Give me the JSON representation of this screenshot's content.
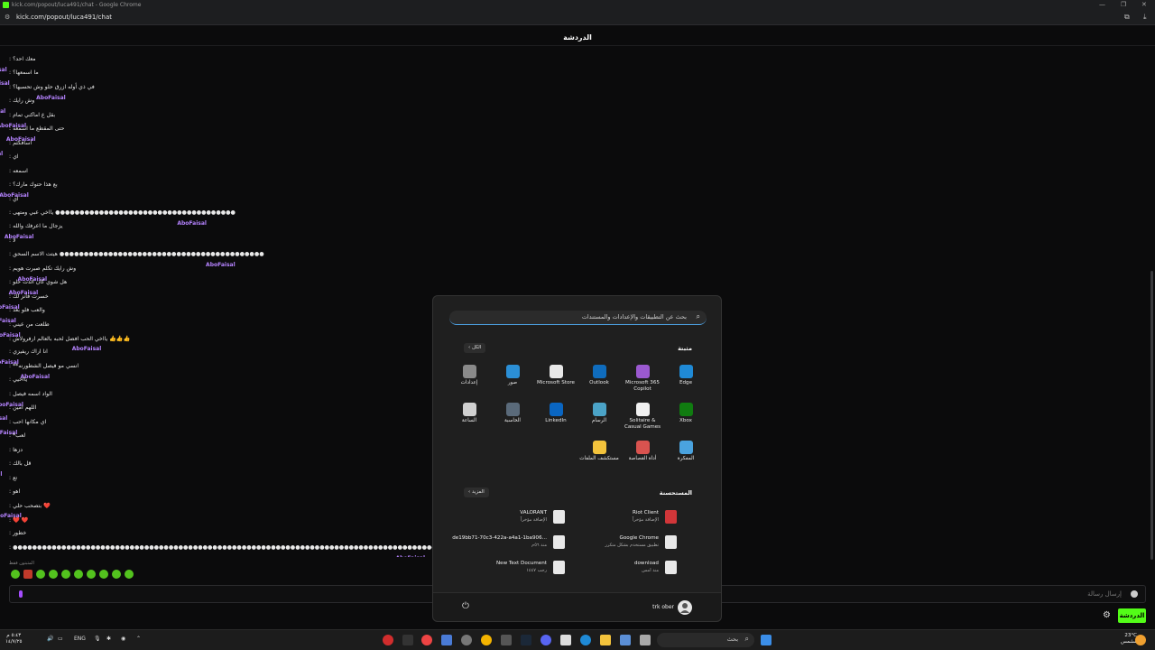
{
  "browser": {
    "window_title": "kick.com/popout/luca491/chat - Google Chrome",
    "url": "kick.com/popout/luca491/chat"
  },
  "chat": {
    "header": "الدردشة",
    "username": "AboFaisal",
    "messages": [
      "معك احد؟",
      "ما اسمعها؟",
      "في ذي أوله ازرق حلو وش تحسبها؟",
      "وش رايك",
      "بقل ع اماكني تمام",
      "حتى المقطع ما اسمعه",
      "اسافكثم",
      "اي",
      "اسمعه",
      "بع هذا حتوك مارك؟",
      "اي",
      "يااخي عبي ومتهى ●●●●●●●●●●●●●●●●●●●●●●●●●●●●●●●●●●●●●",
      "يزجال ما اعرفك والله",
      "لا",
      "هيتت الاسم السحق ●●●●●●●●●●●●●●●●●●●●●●●●●●●●●●●●●●●●●●●●●●",
      "وش رايك تكلم صبرت هويم",
      "هل شوي كان الدت حلو",
      "خسرت فانز لك",
      "والعب فلو بعد",
      "طلعت من عيني",
      "يااخي الحب افضل لحبه بالعالم ارفرولاش 👍👍👍",
      "انا اراك ريفيزي",
      "**انسي مو فيصل الشطورنه",
      "يااخيي",
      "الواد اسمه فيصل",
      "اللهم امين",
      "اي مكانها احب",
      "*لعب",
      "دزها",
      "قل بالك",
      "تع",
      "اهو",
      "بتصحب حلي ❤️",
      "❤️ ❤️",
      "خطور",
      "●●●●●●●●●●●●●●●●●●●●●●●●●●●●●●●●●●●●●●●●●●●●●●●●●●●●●●●●●●●●●●●●●●●●●●●●●●●●●●●●●●●●●●●●●●*"
    ],
    "reply_label": "المثبتون فقط",
    "input_placeholder": "إرسال رسالة",
    "send_button": "الدردشة"
  },
  "start_menu": {
    "search_placeholder": "بحث عن التطبيقات والإعدادات والمستندات",
    "pinned_title": "مثبتة",
    "all_button": "الكل",
    "pinned_apps": [
      {
        "label": "Edge",
        "icon": "edge-icon",
        "color": "#1f8ad6"
      },
      {
        "label": "Microsoft 365 Copilot",
        "icon": "m365-icon",
        "color": "#9b59d0"
      },
      {
        "label": "Outlook",
        "icon": "outlook-icon",
        "color": "#0f6cbd"
      },
      {
        "label": "Microsoft Store",
        "icon": "store-icon",
        "color": "#e8e8e8"
      },
      {
        "label": "صور",
        "icon": "photos-icon",
        "color": "#2b8fd6"
      },
      {
        "label": "إعدادات",
        "icon": "settings-icon",
        "color": "#8a8a8a"
      },
      {
        "label": "Xbox",
        "icon": "xbox-icon",
        "color": "#107c10"
      },
      {
        "label": "Solitaire & Casual Games",
        "icon": "solitaire-icon",
        "color": "#f0f0f0"
      },
      {
        "label": "الرسام",
        "icon": "paint-icon",
        "color": "#4ba3c7"
      },
      {
        "label": "LinkedIn",
        "icon": "linkedin-icon",
        "color": "#0a66c2"
      },
      {
        "label": "الحاسبة",
        "icon": "calculator-icon",
        "color": "#5a6a7a"
      },
      {
        "label": "الساعة",
        "icon": "clock-icon",
        "color": "#d0d0d0"
      },
      {
        "label": "المفكرة",
        "icon": "notepad-icon",
        "color": "#4aa3df"
      },
      {
        "label": "أداة القصاصة",
        "icon": "snipping-icon",
        "color": "#d9534f"
      },
      {
        "label": "مستكشف الملفات",
        "icon": "explorer-icon",
        "color": "#f3c33c"
      }
    ],
    "recommended_title": "المستحسنة",
    "more_button": "المزيد",
    "recommended": [
      {
        "name": "Riot Client",
        "sub": "الإضافة مؤخراً",
        "icon": "riot-icon",
        "color": "#d13639"
      },
      {
        "name": "VALORANT",
        "sub": "الإضافة مؤخراً",
        "icon": "valorant-icon",
        "color": "#e8e8e8"
      },
      {
        "name": "Google Chrome",
        "sub": "تطبيق مستخدم بشكل متكرر",
        "icon": "chrome-icon",
        "color": "#e8e8e8"
      },
      {
        "name": "de19bb71-70c3-422a-a4a1-1ba906...",
        "sub": "منذ ٥٦م",
        "icon": "doc-icon",
        "color": "#e8e8e8"
      },
      {
        "name": "download",
        "sub": "منذ امس",
        "icon": "download-doc-icon",
        "color": "#e8e8e8"
      },
      {
        "name": "New Text Document",
        "sub": "رجب ١٤٤٧",
        "icon": "text-doc-icon",
        "color": "#e8e8e8"
      }
    ],
    "user_name": "trk ober"
  },
  "taskbar": {
    "search_placeholder": "بحث",
    "lang": "ENG",
    "clock_time": "٥:٤٣ م",
    "clock_date": "١٤/٧/٢٥",
    "weather_temp": "23°C",
    "weather_desc": "مشمس",
    "accent": "#53fc18"
  }
}
